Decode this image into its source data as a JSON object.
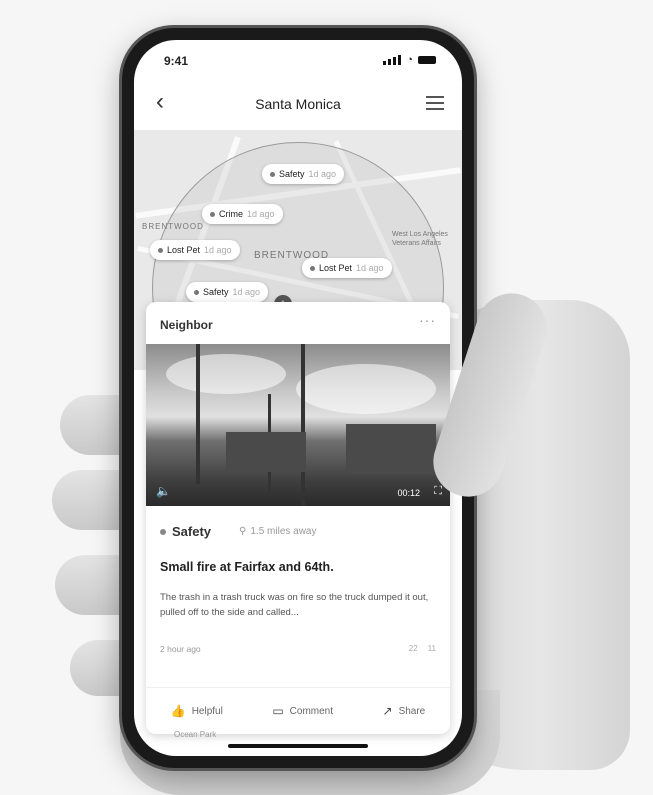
{
  "status": {
    "time": "9:41"
  },
  "nav": {
    "back_icon": "chevron-left-icon",
    "title": "Santa Monica",
    "filter_icon": "sliders-icon"
  },
  "map": {
    "labels": [
      "BRENTWOOD",
      "BRENTWOOD"
    ],
    "pins": [
      {
        "label": "Safety",
        "ago": "1d ago"
      },
      {
        "label": "Crime",
        "ago": "1d ago"
      },
      {
        "label": "Lost Pet",
        "ago": "1d ago"
      },
      {
        "label": "Lost Pet",
        "ago": "1d ago"
      },
      {
        "label": "Safety",
        "ago": "1d ago"
      }
    ],
    "side_text": "West Los Angeles Veterans Affairs",
    "below_label": "Ocean Park"
  },
  "post": {
    "author": "Neighbor",
    "more": "···",
    "video_time": "00:12",
    "category": "Safety",
    "distance": "1.5 miles away",
    "headline": "Small fire at Fairfax and 64th.",
    "body": "The trash in a trash truck was on fire so the truck dumped it out, pulled off to the side and called...",
    "timestamp": "2 hour ago",
    "counts": {
      "helpful": "22",
      "comments": "11"
    },
    "actions": {
      "helpful": "Helpful",
      "comment": "Comment",
      "share": "Share"
    }
  }
}
